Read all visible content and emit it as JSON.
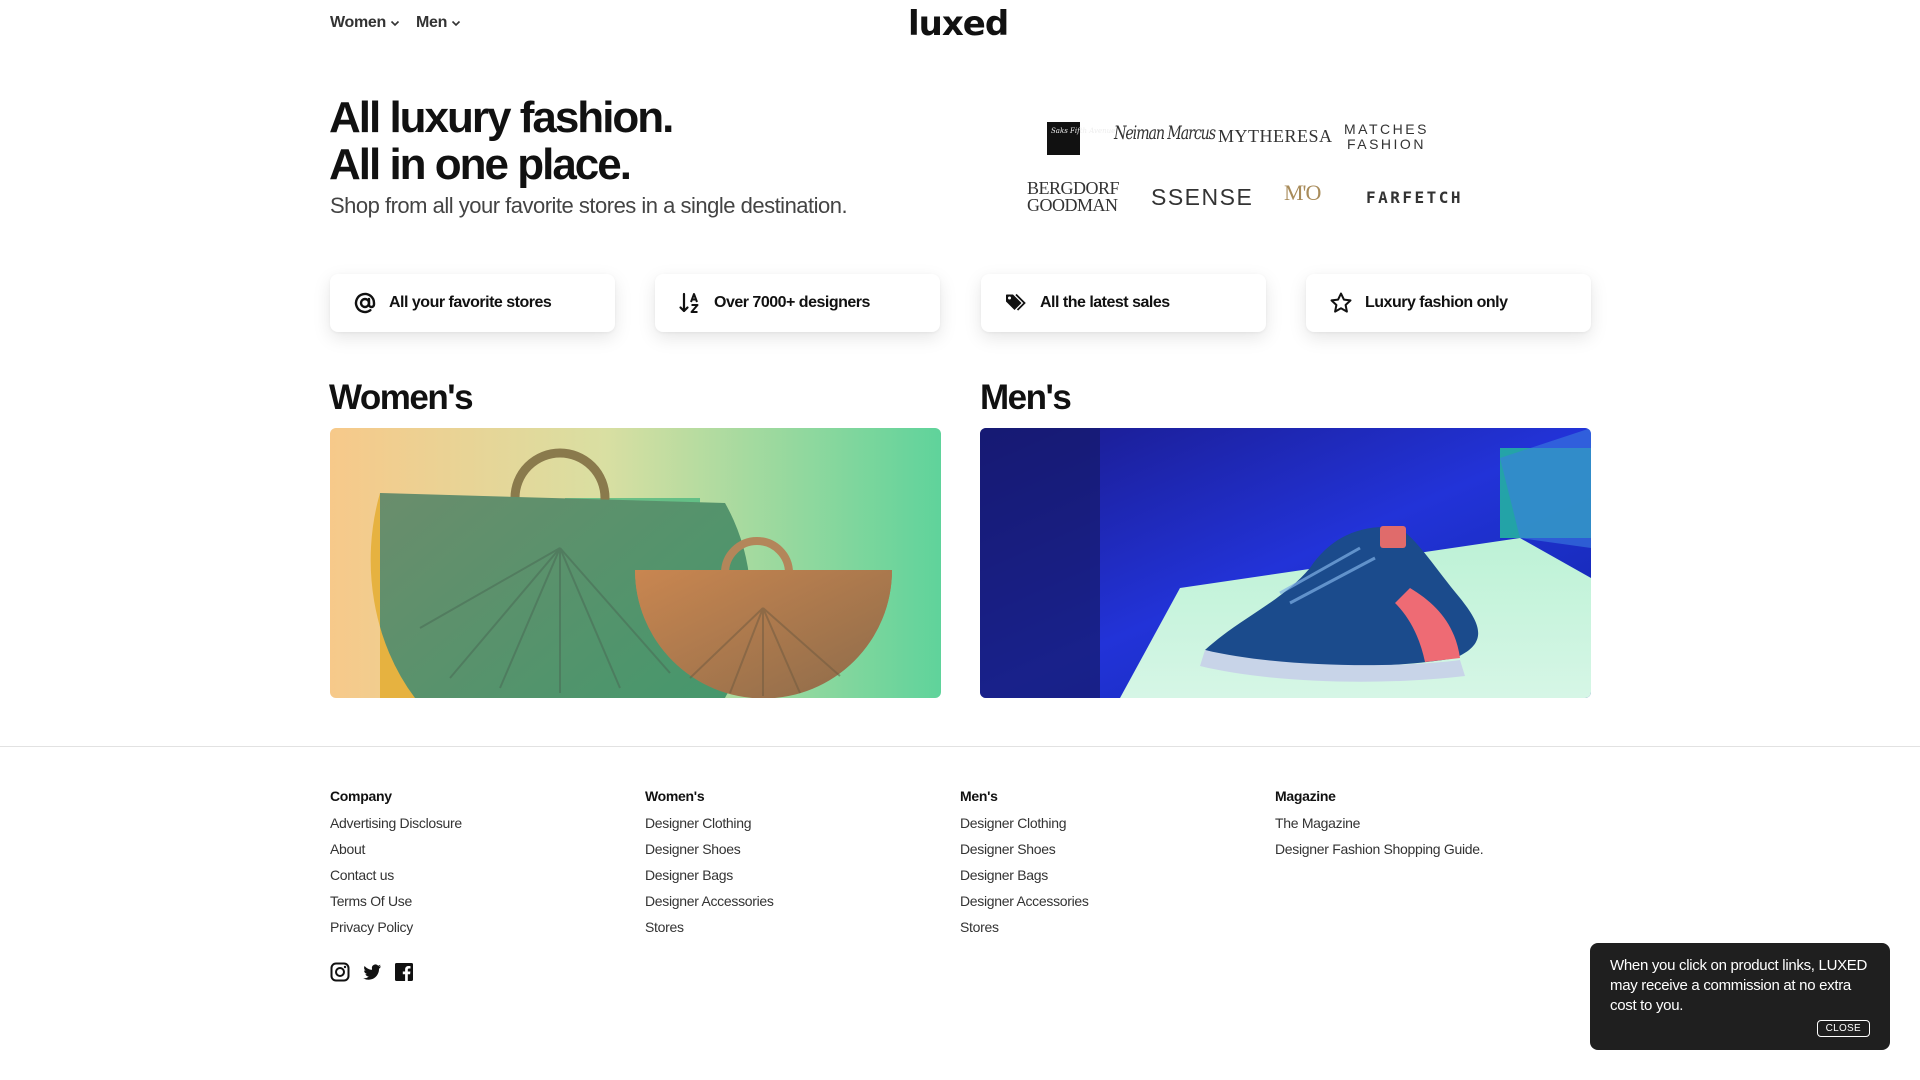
{
  "header": {
    "logo": "luxed",
    "nav": [
      {
        "label": "Women"
      },
      {
        "label": "Men"
      }
    ]
  },
  "hero": {
    "title_line1": "All luxury fashion.",
    "title_line2": "All in one place.",
    "subtitle": "Shop from all your favorite stores in a single destination."
  },
  "stores": {
    "saks": "Saks Fifth Avenue",
    "neiman": "Neiman Marcus",
    "mytheresa": "MYTHERESA",
    "matches_line1": "MATCHES",
    "matches_line2": "FASHION",
    "bergdorf_line1": "BERGDORF",
    "bergdorf_line2": "GOODMAN",
    "ssense": "SSENSE",
    "mo": "M'O",
    "farfetch": "FARFETCH"
  },
  "features": [
    {
      "label": "All your favorite stores",
      "icon": "at-sign-icon"
    },
    {
      "label": "Over 7000+ designers",
      "icon": "sort-alpha-icon"
    },
    {
      "label": "All the latest sales",
      "icon": "tags-icon"
    },
    {
      "label": "Luxury fashion only",
      "icon": "star-icon"
    }
  ],
  "categories": {
    "womens": {
      "title": "Women's",
      "image": "designer handbags"
    },
    "mens": {
      "title": "Men's",
      "image": "sneaker on pedestal"
    }
  },
  "footer": {
    "company": {
      "heading": "Company",
      "links": [
        "Advertising Disclosure",
        "About",
        "Contact us",
        "Terms Of Use",
        "Privacy Policy"
      ]
    },
    "womens": {
      "heading": "Women's",
      "links": [
        "Designer Clothing",
        "Designer Shoes",
        "Designer Bags",
        "Designer Accessories",
        "Stores"
      ]
    },
    "mens": {
      "heading": "Men's",
      "links": [
        "Designer Clothing",
        "Designer Shoes",
        "Designer Bags",
        "Designer Accessories",
        "Stores"
      ]
    },
    "magazine": {
      "heading": "Magazine",
      "links": [
        "The Magazine",
        "Designer Fashion Shopping Guide."
      ]
    },
    "socials": [
      "instagram-icon",
      "twitter-icon",
      "facebook-icon"
    ]
  },
  "toast": {
    "text": "When you click on product links, LUXED may receive a commission at no extra cost to you.",
    "close_label": "CLOSE"
  },
  "colors": {
    "text": "#111111",
    "toast_bg": "#1f1f1f",
    "card_bg": "#ffffff",
    "mo_gold": "#a88b5a"
  }
}
